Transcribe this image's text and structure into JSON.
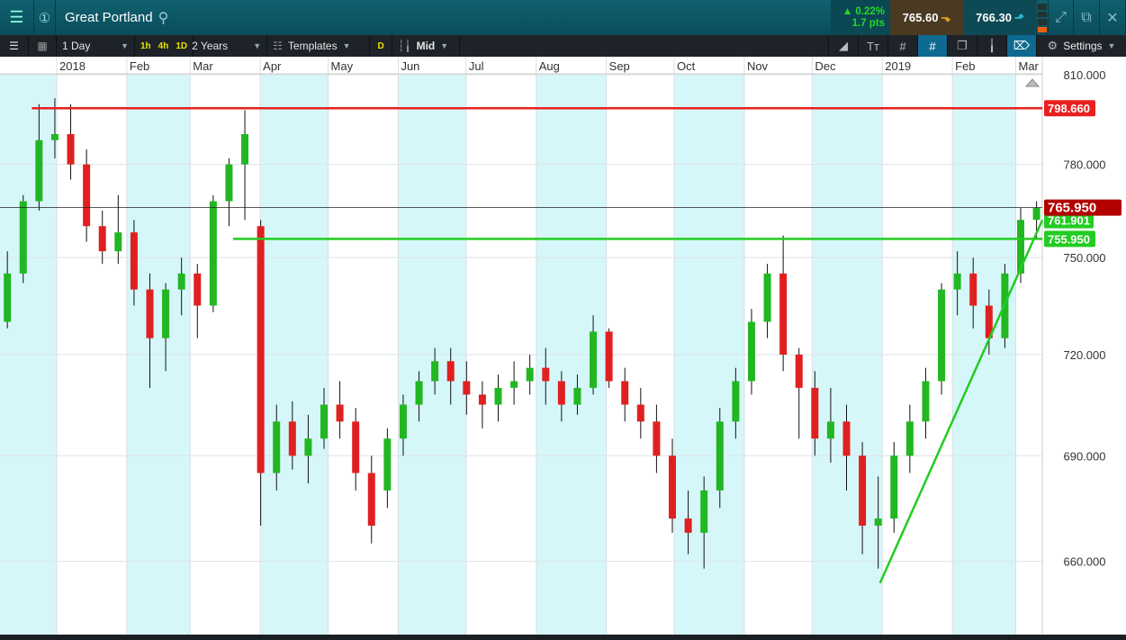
{
  "header": {
    "title": "Great Portland",
    "change_pct": "▲ 0.22%",
    "change_pts": "1.7 pts",
    "sell": "765.60",
    "buy": "766.30"
  },
  "toolbar": {
    "interval": "1 Day",
    "q1": "1h",
    "q2": "4h",
    "q3": "1D",
    "range": "2 Years",
    "templates": "Templates",
    "d": "D",
    "price_type": "Mid",
    "settings": "Settings"
  },
  "colors": {
    "accent": "#0f6070",
    "up": "#22b722",
    "down": "#e02020",
    "band": "#d6f7fa"
  },
  "chart_data": {
    "type": "candlestick",
    "scale": "log",
    "ylim": [
      655,
      812
    ],
    "yticks": [
      "810.000",
      "780.000",
      "750.000",
      "720.000",
      "690.000",
      "660.000"
    ],
    "ytick_values": [
      810,
      780,
      750,
      720,
      690,
      660
    ],
    "months": [
      {
        "label": "2018",
        "date": "2018-01-01"
      },
      {
        "label": "Feb",
        "date": "2018-02-01"
      },
      {
        "label": "Mar",
        "date": "2018-03-01"
      },
      {
        "label": "Apr",
        "date": "2018-04-01"
      },
      {
        "label": "May",
        "date": "2018-05-01"
      },
      {
        "label": "Jun",
        "date": "2018-06-01"
      },
      {
        "label": "Jul",
        "date": "2018-07-01"
      },
      {
        "label": "Aug",
        "date": "2018-08-01"
      },
      {
        "label": "Sep",
        "date": "2018-09-01"
      },
      {
        "label": "Oct",
        "date": "2018-10-01"
      },
      {
        "label": "Nov",
        "date": "2018-11-01"
      },
      {
        "label": "Dec",
        "date": "2018-12-01"
      },
      {
        "label": "2019",
        "date": "2019-01-01"
      },
      {
        "label": "Feb",
        "date": "2019-02-01"
      },
      {
        "label": "Mar",
        "date": "2019-03-01"
      }
    ],
    "weekly_ohlc": [
      [
        730,
        752,
        728,
        745
      ],
      [
        745,
        770,
        742,
        768
      ],
      [
        768,
        800,
        765,
        788
      ],
      [
        788,
        802,
        782,
        790
      ],
      [
        790,
        800,
        775,
        780
      ],
      [
        780,
        785,
        755,
        760
      ],
      [
        760,
        765,
        748,
        752
      ],
      [
        752,
        770,
        748,
        758
      ],
      [
        758,
        762,
        735,
        740
      ],
      [
        740,
        745,
        710,
        725
      ],
      [
        725,
        742,
        715,
        740
      ],
      [
        740,
        750,
        732,
        745
      ],
      [
        745,
        748,
        725,
        735
      ],
      [
        735,
        770,
        733,
        768
      ],
      [
        768,
        782,
        760,
        780
      ],
      [
        780,
        798,
        762,
        790
      ],
      [
        760,
        762,
        670,
        685
      ],
      [
        685,
        705,
        680,
        700
      ],
      [
        700,
        706,
        686,
        690
      ],
      [
        690,
        702,
        682,
        695
      ],
      [
        695,
        710,
        692,
        705
      ],
      [
        705,
        712,
        695,
        700
      ],
      [
        700,
        704,
        680,
        685
      ],
      [
        685,
        690,
        665,
        670
      ],
      [
        680,
        698,
        675,
        695
      ],
      [
        695,
        708,
        690,
        705
      ],
      [
        705,
        715,
        700,
        712
      ],
      [
        712,
        722,
        708,
        718
      ],
      [
        718,
        722,
        705,
        712
      ],
      [
        712,
        718,
        702,
        708
      ],
      [
        708,
        712,
        698,
        705
      ],
      [
        705,
        714,
        700,
        710
      ],
      [
        710,
        718,
        705,
        712
      ],
      [
        712,
        720,
        708,
        716
      ],
      [
        716,
        722,
        705,
        712
      ],
      [
        712,
        715,
        700,
        705
      ],
      [
        705,
        714,
        702,
        710
      ],
      [
        710,
        732,
        708,
        727
      ],
      [
        727,
        728,
        710,
        712
      ],
      [
        712,
        716,
        700,
        705
      ],
      [
        705,
        710,
        695,
        700
      ],
      [
        700,
        705,
        685,
        690
      ],
      [
        690,
        695,
        668,
        672
      ],
      [
        672,
        680,
        662,
        668
      ],
      [
        668,
        684,
        658,
        680
      ],
      [
        680,
        704,
        675,
        700
      ],
      [
        700,
        716,
        695,
        712
      ],
      [
        712,
        734,
        708,
        730
      ],
      [
        730,
        748,
        725,
        745
      ],
      [
        745,
        757,
        715,
        720
      ],
      [
        720,
        722,
        695,
        710
      ],
      [
        710,
        715,
        690,
        695
      ],
      [
        695,
        710,
        688,
        700
      ],
      [
        700,
        705,
        680,
        690
      ],
      [
        690,
        694,
        662,
        670
      ],
      [
        670,
        684,
        658,
        672
      ],
      [
        672,
        694,
        668,
        690
      ],
      [
        690,
        705,
        685,
        700
      ],
      [
        700,
        716,
        695,
        712
      ],
      [
        712,
        742,
        708,
        740
      ],
      [
        740,
        752,
        732,
        745
      ],
      [
        745,
        750,
        728,
        735
      ],
      [
        735,
        740,
        720,
        725
      ],
      [
        725,
        748,
        722,
        745
      ],
      [
        745,
        766,
        742,
        762
      ],
      [
        762,
        768,
        756,
        766
      ]
    ],
    "first_week": "2017-12-07",
    "current_price": {
      "value": 765.95,
      "label": "765.950"
    },
    "resistance": {
      "value": 798.66,
      "label": "798.660",
      "from": "2017-12-21"
    },
    "support": {
      "value": 755.95,
      "label": "755.950",
      "from": "2018-03-20"
    },
    "trendline": {
      "from_date": "2018-12-31",
      "from_value": 654,
      "to_value": 761.901,
      "label": "761.901"
    }
  }
}
